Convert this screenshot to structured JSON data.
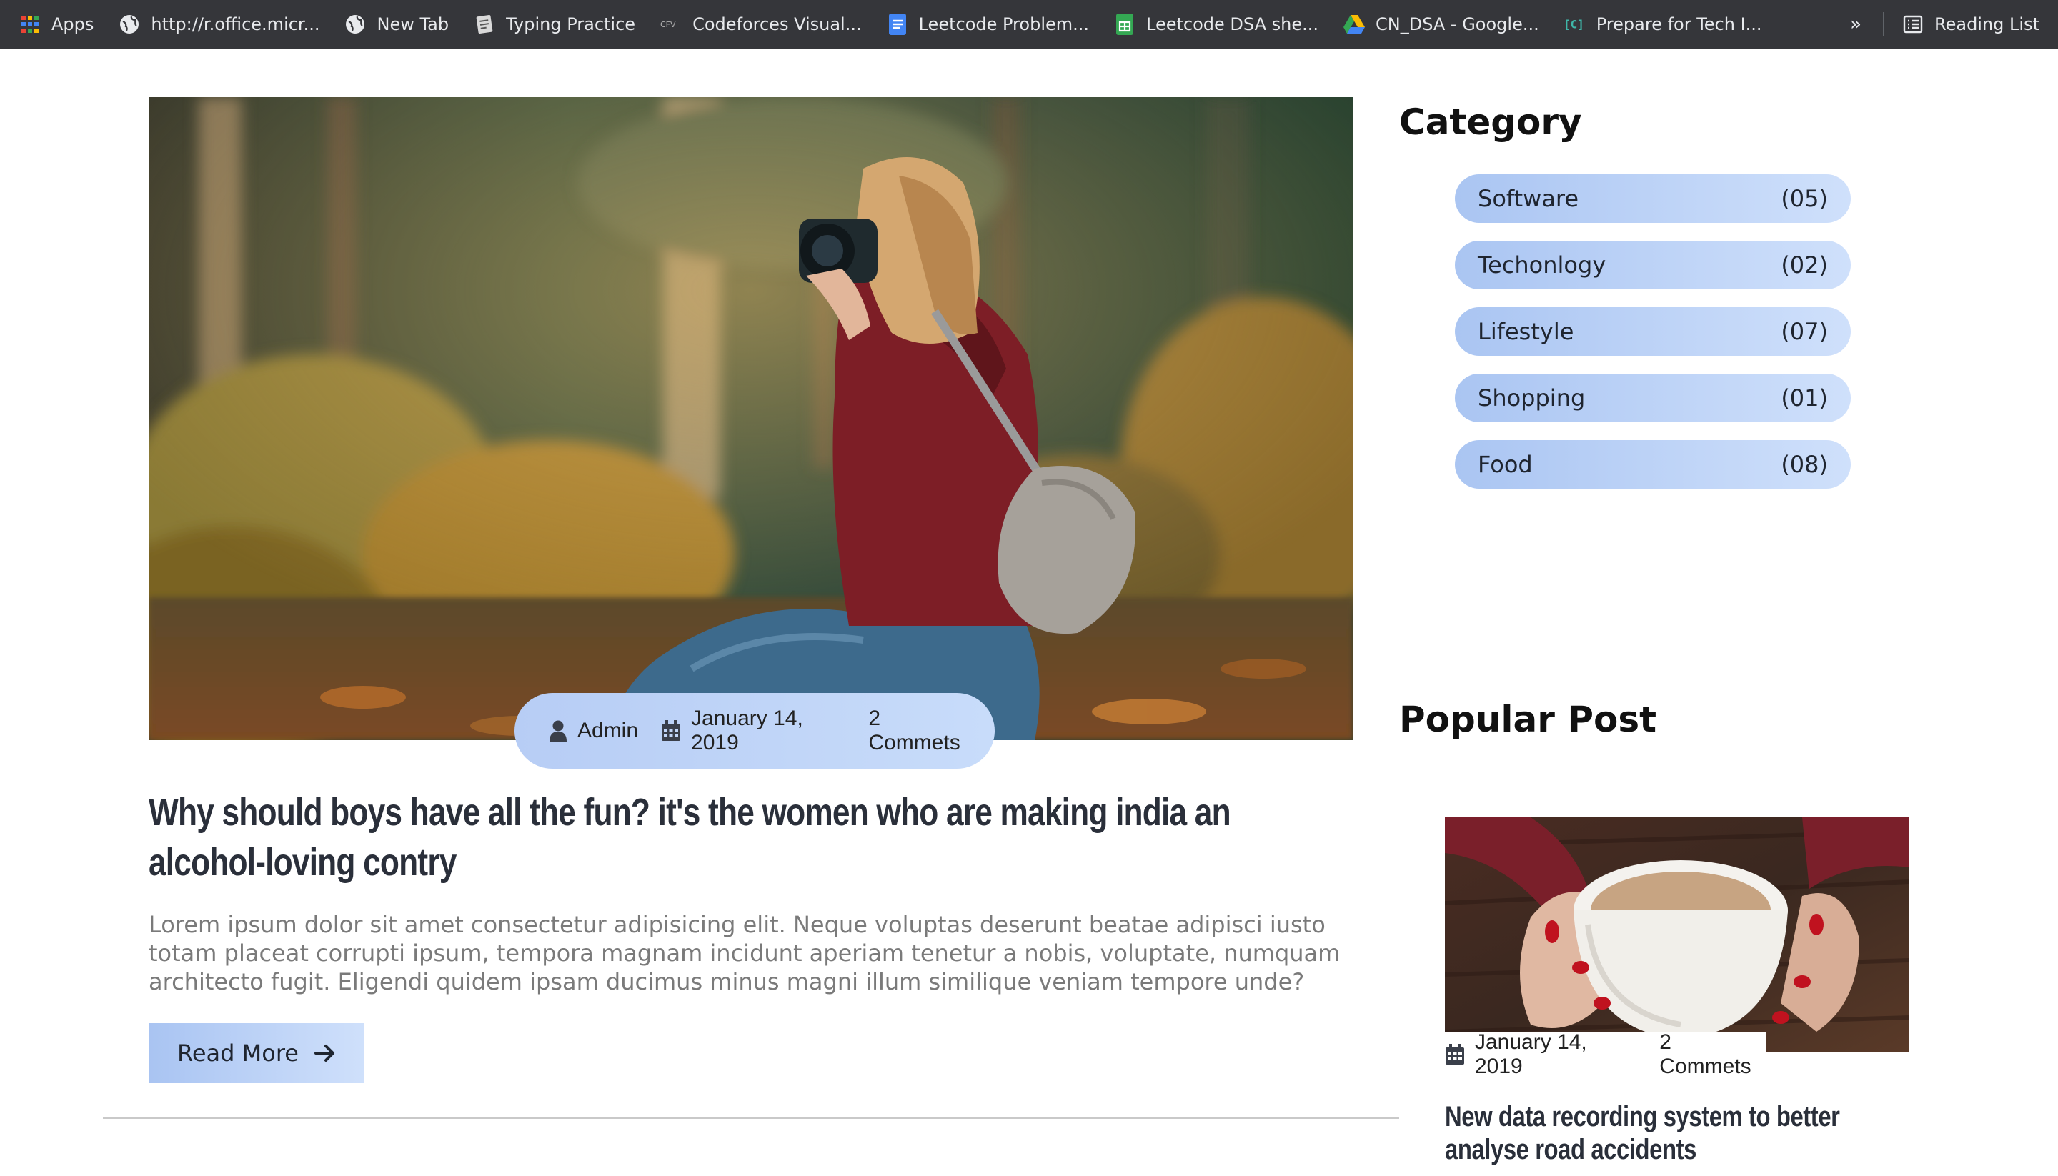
{
  "bookmarks": {
    "items": [
      {
        "label": "Apps",
        "icon": "apps-grid-icon"
      },
      {
        "label": "http://r.office.micr...",
        "icon": "globe-icon"
      },
      {
        "label": "New Tab",
        "icon": "globe-icon"
      },
      {
        "label": "Typing Practice",
        "icon": "typing-practice-icon"
      },
      {
        "label": "Codeforces Visual...",
        "icon": "cfv-icon"
      },
      {
        "label": "Leetcode Problem...",
        "icon": "google-docs-icon"
      },
      {
        "label": "Leetcode DSA she...",
        "icon": "google-sheets-icon"
      },
      {
        "label": "CN_DSA - Google...",
        "icon": "google-drive-icon"
      },
      {
        "label": "Prepare for Tech I...",
        "icon": "code-bracket-icon"
      }
    ],
    "more": "»",
    "reading_list": "Reading List"
  },
  "article": {
    "meta": {
      "author": "Admin",
      "date": "January 14, 2019",
      "comments": "2 Commets"
    },
    "title": "Why should boys have all the fun? it's the women who are making india an alcohol-loving contry",
    "excerpt": "Lorem ipsum dolor sit amet consectetur adipisicing elit. Neque voluptas deserunt beatae adipisci iusto totam placeat corrupti ipsum, tempora magnam incidunt aperiam tenetur a nobis, voluptate, numquam architecto fugit. Eligendi quidem ipsam ducimus minus magni illum similique veniam tempore unde?",
    "read_more": "Read More"
  },
  "sidebar": {
    "category_heading": "Category",
    "categories": [
      {
        "name": "Software",
        "count": "(05)"
      },
      {
        "name": "Techonlogy",
        "count": "(02)"
      },
      {
        "name": "Lifestyle",
        "count": "(07)"
      },
      {
        "name": "Shopping",
        "count": "(01)"
      },
      {
        "name": "Food",
        "count": "(08)"
      }
    ],
    "popular_heading": "Popular Post",
    "popular_post": {
      "date": "January 14, 2019",
      "comments": "2 Commets",
      "title": "New data recording system to better analyse road accidents"
    }
  },
  "colors": {
    "accent_gradient_start": "#aac5f2",
    "accent_gradient_end": "#cfe0fb",
    "bookmarks_bar_bg": "#35363a"
  }
}
